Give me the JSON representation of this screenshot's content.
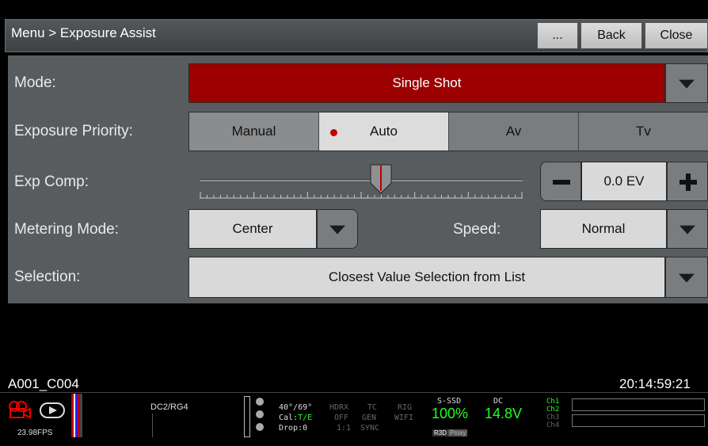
{
  "header": {
    "title": "Menu > Exposure Assist",
    "more_label": "...",
    "back_label": "Back",
    "close_label": "Close"
  },
  "mode": {
    "label": "Mode:",
    "value": "Single Shot"
  },
  "exposure_priority": {
    "label": "Exposure Priority:",
    "options": [
      "Manual",
      "Auto",
      "Av",
      "Tv"
    ],
    "selected": "Auto"
  },
  "exp_comp": {
    "label": "Exp Comp:",
    "value": "0.0 EV",
    "slider_fraction": 0.5
  },
  "metering": {
    "label": "Metering Mode:",
    "value": "Center"
  },
  "speed": {
    "label": "Speed:",
    "value": "Normal"
  },
  "selection": {
    "label": "Selection:",
    "value": "Closest Value Selection from List"
  },
  "monitor": {
    "clip": "A001_C004",
    "timecode": "20:14:59:21"
  },
  "status": {
    "fps": "23.98FPS",
    "look": "DC2/RG4",
    "temp": "40°/69°",
    "cal_label": "Cal:",
    "cal_value": "T/E",
    "drop": "Drop:0",
    "hdrx": "HDRX",
    "hdrx_val": "OFF",
    "hdrx_ratio": "1:1",
    "tc": "TC",
    "tc_val": "GEN",
    "tc_sync": "SYNC",
    "rig": "RIG",
    "rig_val": "WIFI",
    "media": "S-SSD",
    "media_pct": "100%",
    "media_tag1": "R3D",
    "media_tag2": "Proxy",
    "power": "DC",
    "voltage": "14.8V",
    "channels": [
      "Ch1",
      "Ch2",
      "Ch3",
      "Ch4"
    ]
  },
  "colors": {
    "accent_red": "#9c0000",
    "active_green": "#22ff22"
  }
}
